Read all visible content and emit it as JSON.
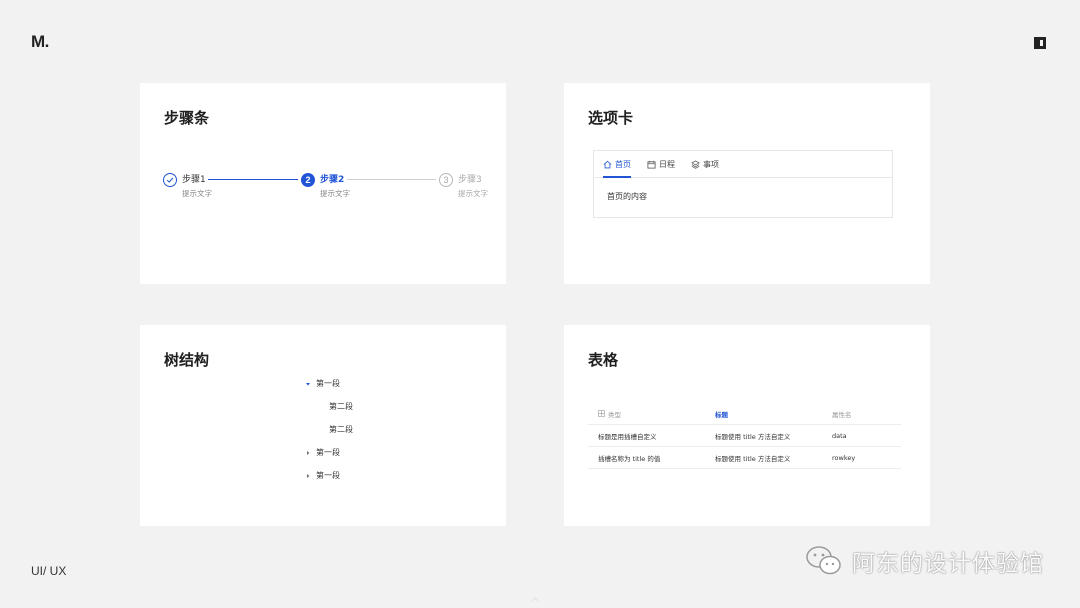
{
  "brand": {
    "logo_text": "M.",
    "footer_label": "UI/ UX",
    "watermark_text": "阿东的设计体验馆"
  },
  "colors": {
    "accent": "#2255d6",
    "background": "#f2f2f2",
    "card": "#ffffff",
    "muted": "#aaaaaa"
  },
  "steps_card": {
    "title": "步骤条",
    "steps": [
      {
        "title": "步骤1",
        "number": "1",
        "status": "done",
        "desc": "提示文字"
      },
      {
        "title": "步骤2",
        "number": "2",
        "status": "active",
        "desc": "提示文字"
      },
      {
        "title": "步骤3",
        "number": "3",
        "status": "wait",
        "desc": "提示文字"
      }
    ]
  },
  "tabs_card": {
    "title": "选项卡",
    "tabs": [
      {
        "label": "首页",
        "icon": "home-icon",
        "active": true
      },
      {
        "label": "日程",
        "icon": "calendar-icon",
        "active": false
      },
      {
        "label": "事项",
        "icon": "layers-icon",
        "active": false
      }
    ],
    "content": "首页的内容"
  },
  "tree_card": {
    "title": "树结构",
    "nodes": [
      {
        "label": "第一段",
        "level": 0,
        "expanded": true
      },
      {
        "label": "第二段",
        "level": 1
      },
      {
        "label": "第二段",
        "level": 1
      },
      {
        "label": "第一段",
        "level": 0,
        "expanded": false
      },
      {
        "label": "第一段",
        "level": 0,
        "expanded": false
      }
    ]
  },
  "table_card": {
    "title": "表格",
    "headers": [
      "类型",
      "标题",
      "属性名"
    ],
    "rows": [
      [
        "标题是用插槽自定义",
        "标题使用 title 方法自定义",
        "data"
      ],
      [
        "插槽名称为 title 的值",
        "标题使用 title 方法自定义",
        "rowkey"
      ]
    ]
  }
}
